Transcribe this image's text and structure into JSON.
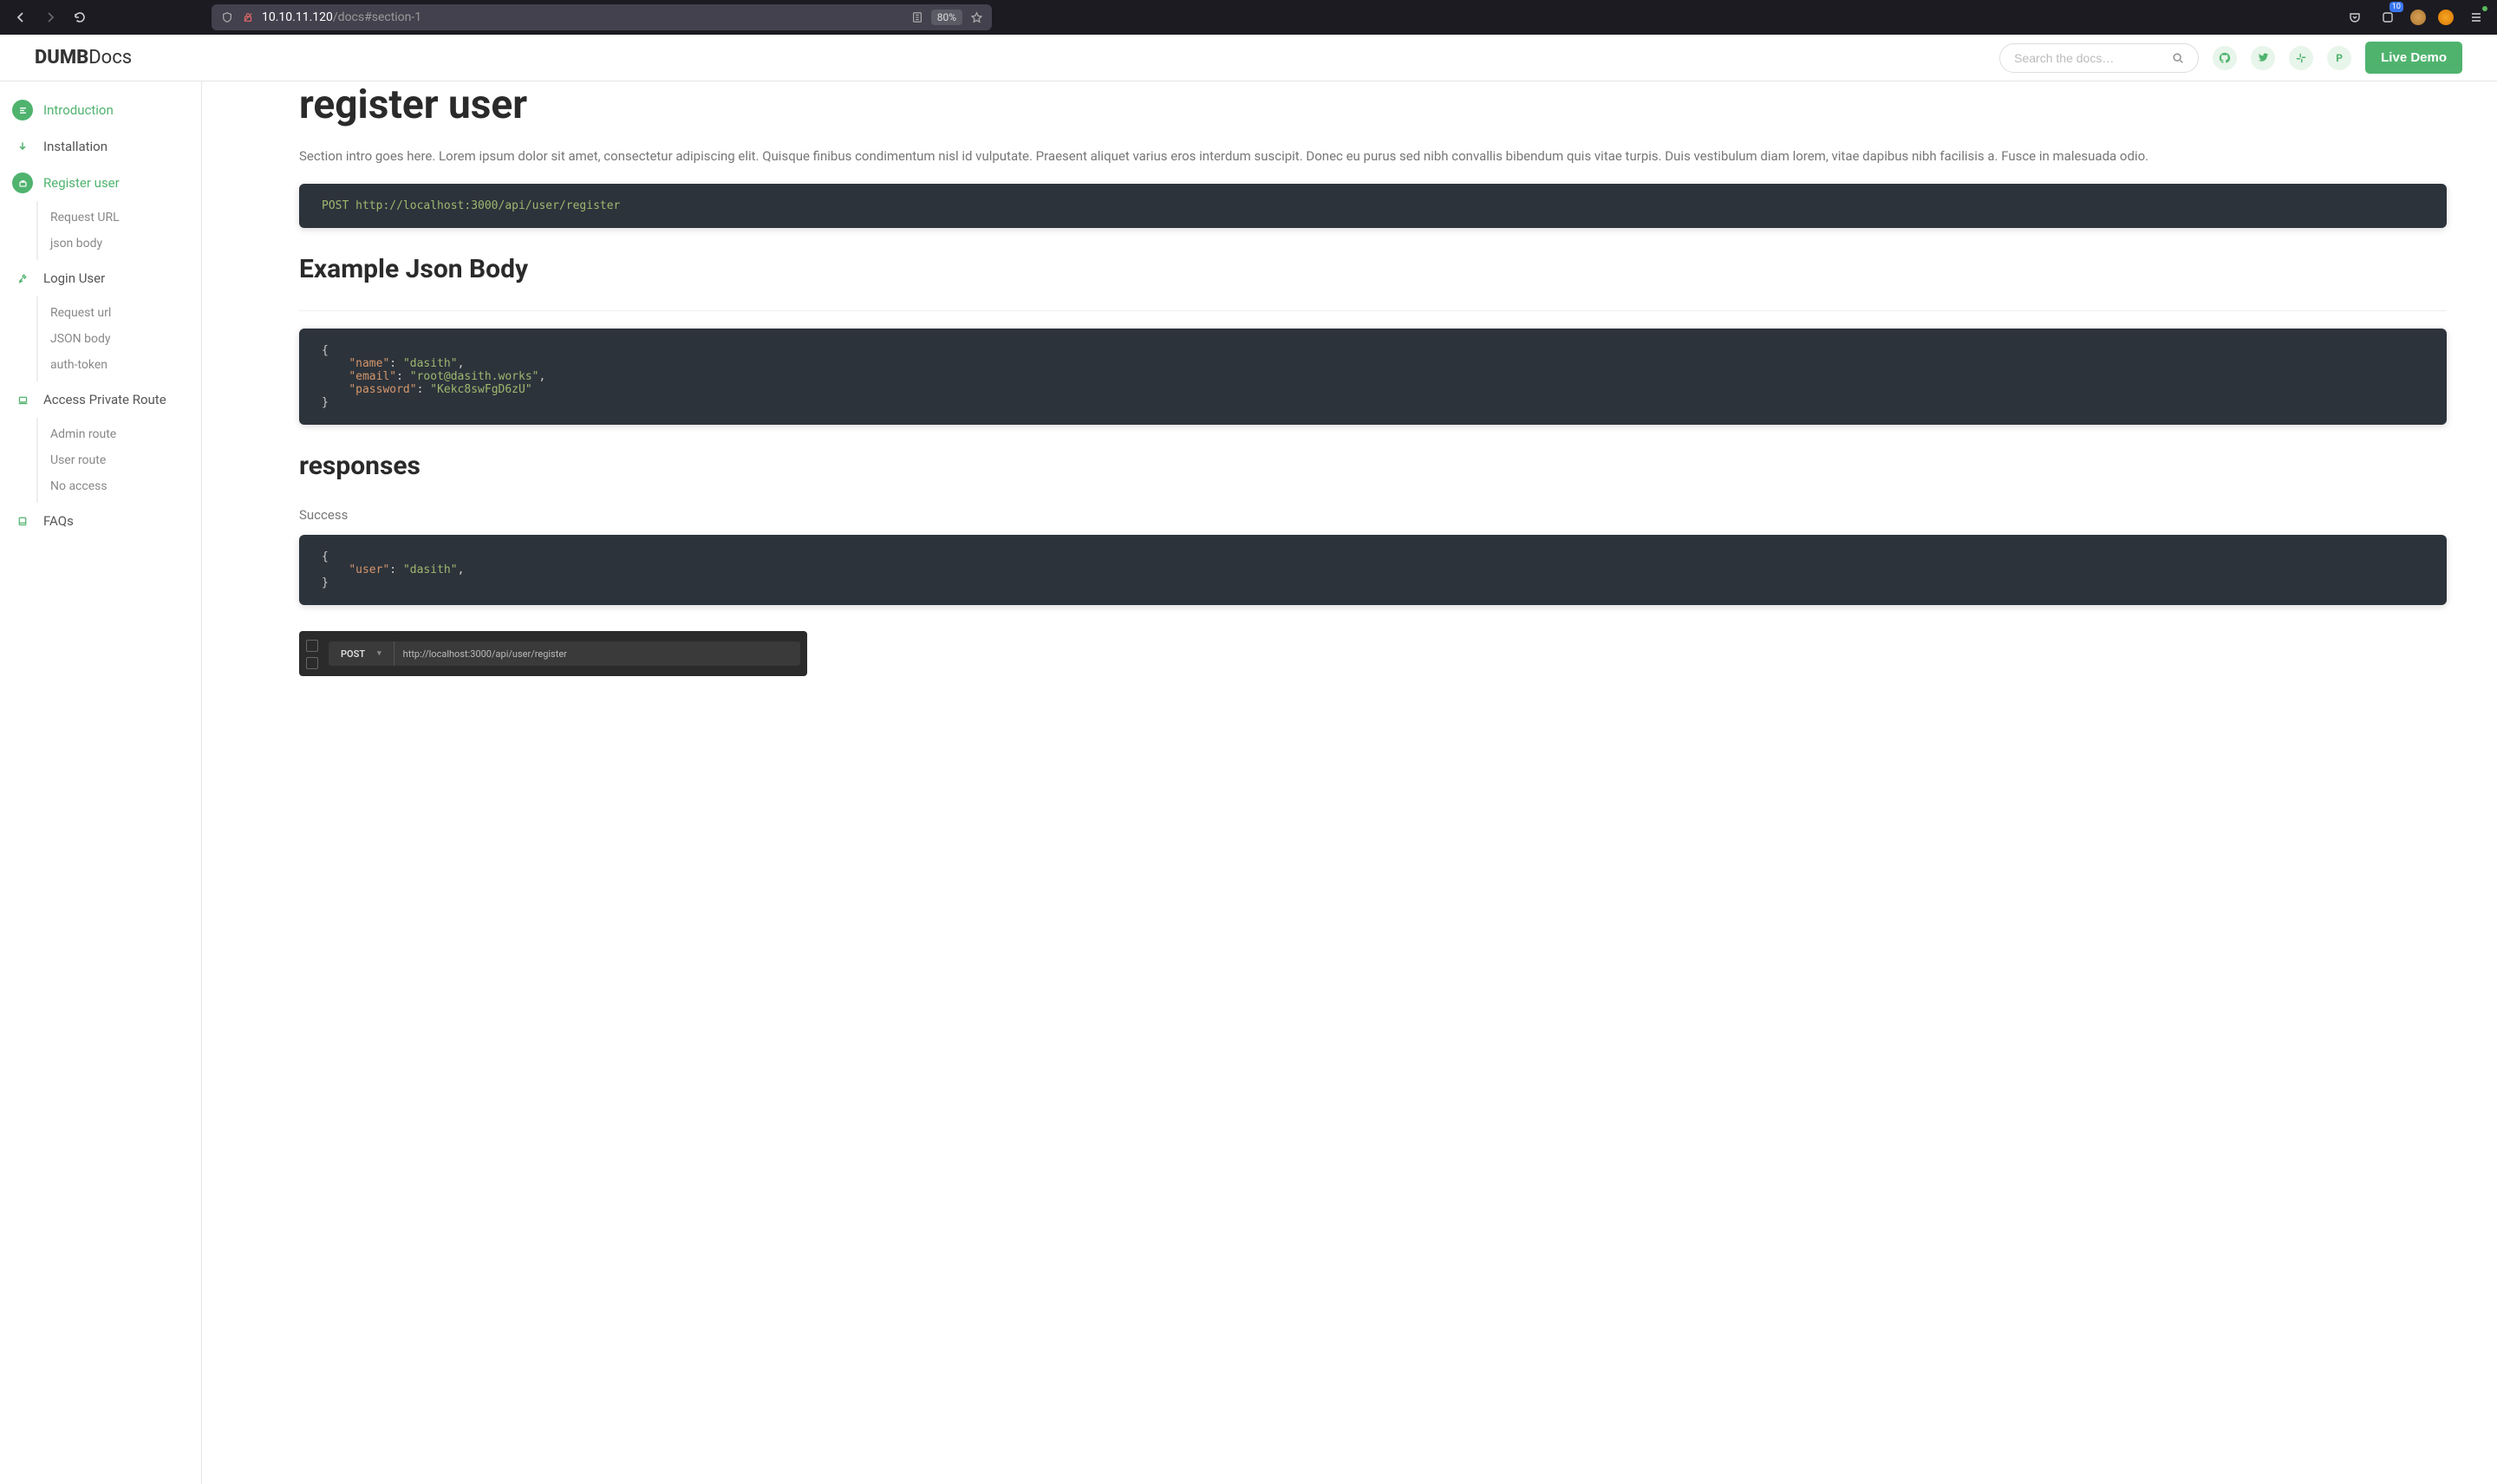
{
  "browser": {
    "url_host": "10.10.11.120",
    "url_path": "/docs#section-1",
    "zoom": "80%",
    "badge_count": "10"
  },
  "header": {
    "logo_bold": "DUMB",
    "logo_light": "Docs",
    "search_placeholder": "Search the docs…",
    "live_demo": "Live Demo"
  },
  "sidebar": {
    "items": [
      {
        "label": "Introduction",
        "icon": "align"
      },
      {
        "label": "Installation",
        "icon": "download"
      },
      {
        "label": "Register user",
        "icon": "briefcase"
      },
      {
        "label": "Login User",
        "icon": "tools"
      },
      {
        "label": "Access Private Route",
        "icon": "laptop"
      },
      {
        "label": "FAQs",
        "icon": "book"
      }
    ],
    "register_sub": [
      {
        "label": "Request URL"
      },
      {
        "label": "json body"
      }
    ],
    "login_sub": [
      {
        "label": "Request url"
      },
      {
        "label": "JSON body"
      },
      {
        "label": "auth-token"
      }
    ],
    "private_sub": [
      {
        "label": "Admin route"
      },
      {
        "label": "User route"
      },
      {
        "label": "No access"
      }
    ]
  },
  "content": {
    "title": "register user",
    "intro": "Section intro goes here. Lorem ipsum dolor sit amet, consectetur adipiscing elit. Quisque finibus condimentum nisl id vulputate. Praesent aliquet varius eros interdum suscipit. Donec eu purus sed nibh convallis bibendum quis vitae turpis. Duis vestibulum diam lorem, vitae dapibus nibh facilisis a. Fusce in malesuada odio.",
    "code1_method": "POST",
    "code1_url": "http://localhost:3000/api/user/register",
    "h2_1": "Example Json Body",
    "json_body": {
      "k1": "\"name\"",
      "v1": "\"dasith\"",
      "k2": "\"email\"",
      "v2": "\"root@dasith.works\"",
      "k3": "\"password\"",
      "v3": "\"Kekc8swFgD6zU\""
    },
    "h2_2": "responses",
    "success_label": "Success",
    "resp_body": {
      "k1": "\"user\"",
      "v1": "\"dasith\""
    },
    "postman": {
      "method": "POST",
      "url": "http://localhost:3000/api/user/register"
    }
  }
}
